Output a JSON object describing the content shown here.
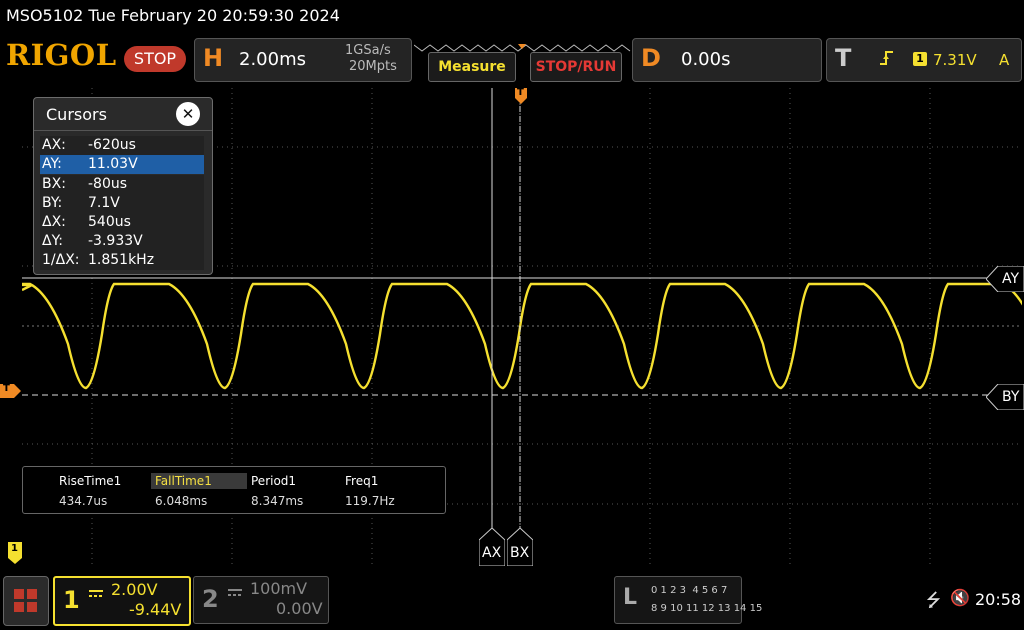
{
  "titlebar": {
    "text": "MSO5102  Tue February 20 20:59:30 2024"
  },
  "brand": {
    "logo": "RIGOL",
    "run_state": "STOP"
  },
  "horizontal": {
    "key": "H",
    "timebase": "2.00ms",
    "sample_rate": "1GSa/s",
    "memory_depth": "20Mpts"
  },
  "buttons": {
    "measure": "Measure",
    "stop_run": "STOP/RUN"
  },
  "delay": {
    "key": "D",
    "value": "0.00s"
  },
  "trigger": {
    "key": "T",
    "source": "1",
    "level": "7.31V",
    "mode": "A",
    "marker": "T"
  },
  "cursors": {
    "title": "Cursors",
    "close": "✕",
    "rows": [
      {
        "label": "AX:",
        "value": "-620us"
      },
      {
        "label": "AY:",
        "value": "11.03V"
      },
      {
        "label": "BX:",
        "value": "-80us"
      },
      {
        "label": "BY:",
        "value": "7.1V"
      },
      {
        "label": "ΔX:",
        "value": "540us"
      },
      {
        "label": "ΔY:",
        "value": "-3.933V"
      },
      {
        "label": "1/ΔX:",
        "value": "1.851kHz"
      }
    ],
    "ay_tag": "AY",
    "by_tag": "BY",
    "ax_tag": "AX",
    "bx_tag": "BX"
  },
  "measurements": {
    "items": [
      {
        "name": "RiseTime1",
        "value": "434.7us"
      },
      {
        "name": "FallTime1",
        "value": "6.048ms"
      },
      {
        "name": "Period1",
        "value": "8.347ms"
      },
      {
        "name": "Freq1",
        "value": "119.7Hz"
      }
    ]
  },
  "markers": {
    "trigger_level": "T",
    "ch1_ground": "1"
  },
  "channels": {
    "ch1": {
      "number": "1",
      "scale": "2.00V",
      "offset": "-9.44V",
      "color": "#f5e030"
    },
    "ch2": {
      "number": "2",
      "scale": "100mV",
      "offset": "0.00V",
      "color": "#888888"
    }
  },
  "logic": {
    "key": "L",
    "row1": "0 1 2 3  4 5 6 7",
    "row2": "8 9 10 11 12 13 14 15"
  },
  "status": {
    "usb": "⭍",
    "mute": "🔇",
    "time": "20:58"
  },
  "colors": {
    "accent_orange": "#f08a24",
    "trace_yellow": "#f5e030",
    "stop_red": "#c0392b"
  }
}
